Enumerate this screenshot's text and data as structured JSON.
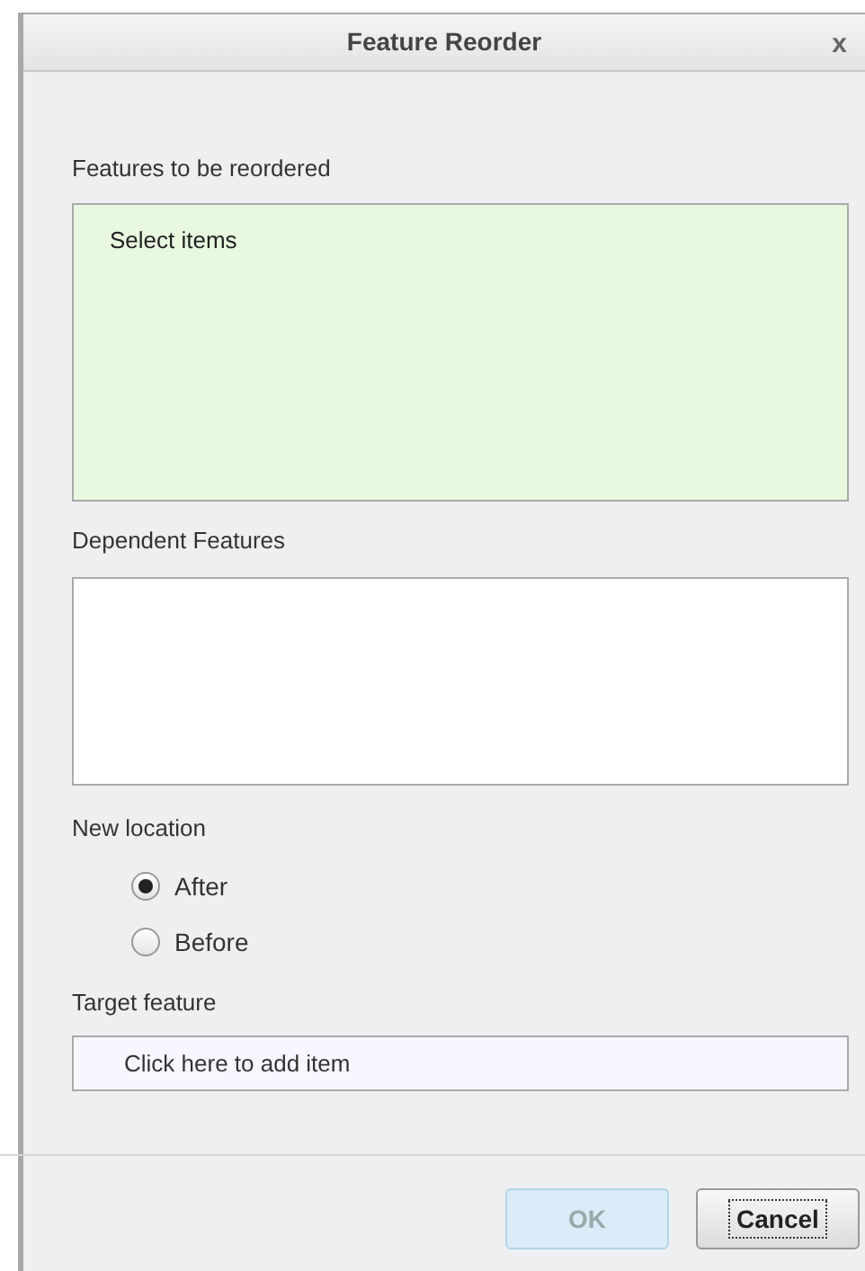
{
  "window": {
    "title": "Feature Reorder",
    "close": "x"
  },
  "features_to_reorder": {
    "label": "Features to be reordered",
    "placeholder": "Select items"
  },
  "dependent_features": {
    "label": "Dependent Features"
  },
  "new_location": {
    "label": "New location",
    "options": [
      {
        "label": "After",
        "selected": true
      },
      {
        "label": "Before",
        "selected": false
      }
    ]
  },
  "target_feature": {
    "label": "Target feature",
    "placeholder": "Click here to add item"
  },
  "buttons": [
    {
      "label": "OK",
      "disabled": true,
      "focused": false
    },
    {
      "label": "Cancel",
      "disabled": false,
      "focused": true
    }
  ]
}
